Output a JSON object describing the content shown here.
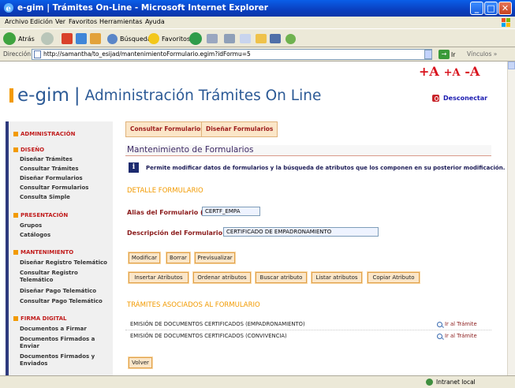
{
  "window": {
    "title": "e-gim  |  Trámites On-Line - Microsoft Internet Explorer",
    "btn_min": "_",
    "btn_max": "□",
    "btn_close": "✕"
  },
  "menu": [
    "Archivo",
    "Edición",
    "Ver",
    "Favoritos",
    "Herramientas",
    "Ayuda"
  ],
  "toolbar": {
    "back": "Atrás",
    "search": "Búsqueda",
    "favorites": "Favoritos"
  },
  "address": {
    "label": "Dirección",
    "url": "http://samantha/to_esijad/mantenimientoFormulario.egim?idFormu=5",
    "go": "Ir",
    "links": "Vínculos »",
    "go_arrow": "→"
  },
  "status": {
    "zone": "Intranet local"
  },
  "page": {
    "font_sizes": [
      "+A",
      "+A",
      "-A"
    ],
    "brand": "e-gim",
    "brand_sep": "|",
    "tagline": "Administración Trámites On Line",
    "logout": "Desconectar"
  },
  "sidebar": {
    "sections": [
      {
        "title": "ADMINISTRACIÓN",
        "items": []
      },
      {
        "title": "DISEÑO",
        "items": [
          "Diseñar Trámites",
          "Consultar Trámites",
          "Diseñar Formularios",
          "Consultar Formularios",
          "Consulta Simple"
        ]
      },
      {
        "title": "PRESENTACIÓN",
        "items": [
          "Grupos",
          "Catálogos"
        ]
      },
      {
        "title": "MANTENIMIENTO",
        "items": [
          "Diseñar Registro Telemático",
          "Consultar Registro Telemático",
          "Diseñar Pago Telemático",
          "Consultar Pago Telemático"
        ]
      },
      {
        "title": "FIRMA DIGITAL",
        "items": [
          "Documentos a Firmar",
          "Documentos Firmados a Enviar",
          "Documentos Firmados y Enviados"
        ]
      }
    ]
  },
  "tabs": [
    "Consultar Formularios",
    "Diseñar Formularios"
  ],
  "main": {
    "title": "Mantenimiento de Formularios",
    "info_icon": "i",
    "info": "Permite modificar datos de formularios y la búsqueda de atributos que los componen en su posterior modificación.",
    "detail_head": "DETALLE FORMULARIO",
    "alias_label": "Alias del Formulario (*)",
    "alias_value": "CERTF_EMPA",
    "desc_label": "Descripción del Formulario (*)",
    "desc_value": "CERTIFICADO DE EMPADRONAMIENTO",
    "buttons_row1": [
      "Modificar",
      "Borrar",
      "Previsualizar"
    ],
    "buttons_row2": [
      "Insertar Atributos",
      "Ordenar atributos",
      "Buscar atributo",
      "Listar atributos",
      "Copiar Atributo"
    ],
    "tramites_head": "TRÁMITES ASOCIADOS AL FORMULARIO",
    "tramites": [
      {
        "name": "EMISIÓN DE DOCUMENTOS CERTIFICADOS (EMPADRONAMIENTO)",
        "link": "Ir al Trámite"
      },
      {
        "name": "EMISIÓN DE DOCUMENTOS CERTIFICADOS (CONVIVENCIA)",
        "link": "Ir al Trámite"
      }
    ],
    "back": "Volver"
  }
}
